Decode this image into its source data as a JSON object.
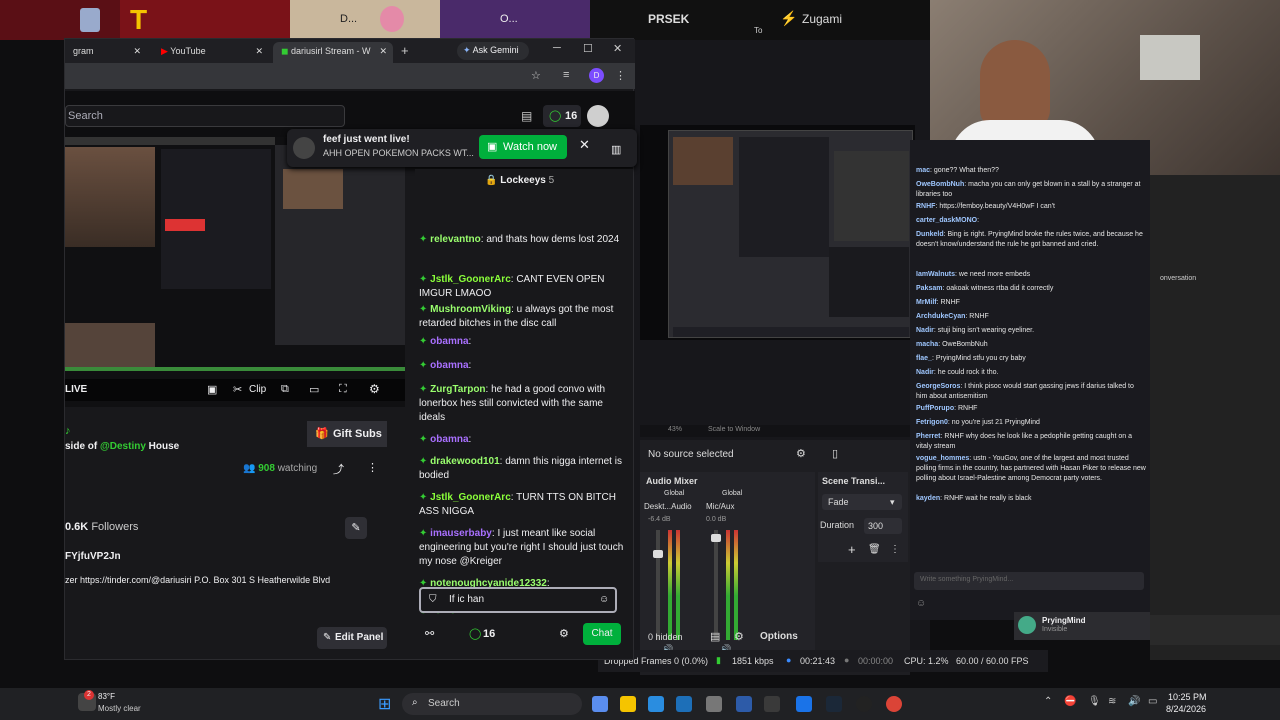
{
  "browser": {
    "tabs": [
      {
        "label": "gram",
        "active": false
      },
      {
        "label": "YouTube",
        "active": false
      },
      {
        "label": "dariusirl Stream - W",
        "active": true
      }
    ],
    "gemini": "Ask Gemini",
    "profile_initial": "D"
  },
  "desktop_tiles": [
    "D...",
    "O...",
    "PRSEK",
    "Zugami",
    "To"
  ],
  "twitch": {
    "search_placeholder": "Search",
    "points": "16",
    "player": {
      "live": "LIVE",
      "clip": "Clip"
    },
    "gift_subs": "Gift Subs",
    "title_prefix": "side of",
    "title_mention": "@Destiny",
    "title_suffix": "House",
    "watching_count": "908",
    "watching_label": "watching",
    "followers_count": "0.6K",
    "followers_label": "Followers",
    "handle": "FYjfuVP2Jn",
    "bio": "zer https://tinder.com/@dariusiri P.O. Box 301 S Heatherwilde Blvd",
    "edit_panel": "Edit Panel"
  },
  "notification": {
    "title": "feef just went live!",
    "subtitle": "AHH OPEN POKEMON PACKS WT...",
    "watch_label": "Watch now"
  },
  "chat": {
    "pinned": "Lockeeys",
    "pinned_count": "5",
    "messages": [
      {
        "user": "relevantno",
        "color": "#9aff6e",
        "text": "and thats how dems lost 2024"
      },
      {
        "user": "Jstlk_GoonerArc",
        "color": "#8aff3a",
        "text": "CANT EVEN OPEN IMGUR LMAOO"
      },
      {
        "user": "MushroomViking",
        "color": "#9aff6e",
        "text": "u always got the most retarded bitches in the disc call"
      },
      {
        "user": "obamna",
        "color": "#a970ff",
        "text": ""
      },
      {
        "user": "obamna",
        "color": "#a970ff",
        "text": ""
      },
      {
        "user": "ZurgTarpon",
        "color": "#9aff6e",
        "text": "he had a good convo with lonerbox hes still convicted with the same ideals"
      },
      {
        "user": "obamna",
        "color": "#a970ff",
        "text": ""
      },
      {
        "user": "drakewood101",
        "color": "#9aff6e",
        "text": "damn this nigga internet is bodied"
      },
      {
        "user": "Jstlk_GoonerArc",
        "color": "#8aff3a",
        "text": "TURN TTS ON BITCH ASS NIGGA"
      },
      {
        "user": "imauserbaby",
        "color": "#a970ff",
        "text": "I just meant like social engineering but you're right I should just touch my nose @Kreiger"
      },
      {
        "user": "notenoughcyanide12332",
        "color": "#9aff6e",
        "text": ""
      }
    ],
    "input_value": "If ic han",
    "points": "16",
    "chat_button": "Chat"
  },
  "obs": {
    "no_source": "No source selected",
    "audio_mixer": "Audio Mixer",
    "scene_transitions": "Scene Transi...",
    "global1": "Global",
    "global2": "Global",
    "track1": "Deskt...Audio",
    "track2": "Mic/Aux",
    "db_value": "-6.4 dB",
    "db_value2": "0.0 dB",
    "fade": "Fade",
    "duration_label": "Duration",
    "duration_value": "300",
    "hidden": "0 hidden",
    "options": "Options",
    "zoom": "43%",
    "scale_to_window": "Scale to Window",
    "status": {
      "dropped": "Dropped Frames 0 (0.0%)",
      "kbps": "1851 kbps",
      "live_time": "00:21:43",
      "rec_time": "00:00:00",
      "cpu": "CPU: 1.2%",
      "fps": "60.00 / 60.00 FPS"
    },
    "meter_scale": [
      "-5",
      "-10",
      "-15",
      "-20",
      "-25",
      "-30",
      "-35",
      "-40",
      "-45",
      "-50",
      "-55",
      "-60"
    ]
  },
  "right_chat": {
    "messages": [
      {
        "user": "mac",
        "text": "gone?? What then??"
      },
      {
        "user": "OweBombNuh",
        "text": "macha you can only get blown in a stall by a stranger at libraries too"
      },
      {
        "user": "RNHF",
        "text": "https://femboy.beauty/V4H0wF I can't"
      },
      {
        "user": "carter_daskMONO",
        "text": ""
      },
      {
        "user": "Dunkeld",
        "text": "Bing is right. PryingMind broke the rules twice, and because he doesn't know/understand the rule he got banned and cried."
      },
      {
        "user": "IamWalnuts",
        "text": "we need more embeds"
      },
      {
        "user": "Paksam",
        "text": "oakoak witness rtba did it correctly"
      },
      {
        "user": "MrMilf",
        "text": "RNHF"
      },
      {
        "user": "ArchdukeCyan",
        "text": "RNHF"
      },
      {
        "user": "Nadir",
        "text": "stuji bing isn't wearing eyeliner."
      },
      {
        "user": "macha",
        "text": "OweBombNuh"
      },
      {
        "user": "flae_",
        "text": "PryingMind stfu you cry baby"
      },
      {
        "user": "Nadir",
        "text": "he could rock it tho."
      },
      {
        "user": "GeorgeSoros",
        "text": "I think pisoc would start gassing jews if darius talked to him about antisemitism"
      },
      {
        "user": "PuffPorupo",
        "text": "RNHF"
      },
      {
        "user": "Fetrigon0",
        "text": "no you're just 21 PryingMind"
      },
      {
        "user": "Pherret",
        "text": "RNHF why does he look like a pedophile getting caught on a vitaly stream"
      },
      {
        "user": "vogue_hommes",
        "text": "ustn - YouGov, one of the largest and most trusted polling firms in the country, has partnered with Hasan Piker to release new polling about Israel-Palestine among Democrat party voters."
      },
      {
        "user": "kayden",
        "text": "RNHF wait he really is black"
      }
    ],
    "input_placeholder": "Write something PryingMind...",
    "user": "PryingMind",
    "user_status": "Invisible",
    "conversation": "onversation"
  },
  "taskbar": {
    "weather_temp": "83°F",
    "weather_desc": "Mostly clear",
    "weather_badge": "2",
    "search": "Search",
    "time": "10:25 PM",
    "date": "8/24/2026"
  }
}
